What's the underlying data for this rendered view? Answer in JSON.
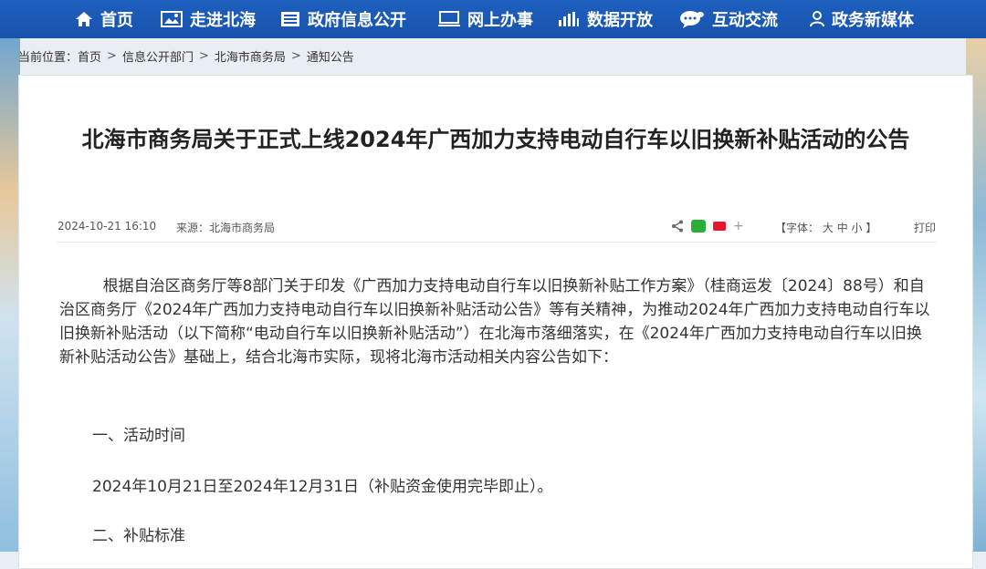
{
  "nav": {
    "items": [
      {
        "label": "首页",
        "icon": "home-icon"
      },
      {
        "label": "走进北海",
        "icon": "picture-icon"
      },
      {
        "label": "政府信息公开",
        "icon": "document-icon"
      },
      {
        "label": "网上办事",
        "icon": "monitor-icon"
      },
      {
        "label": "数据开放",
        "icon": "bar-chart-icon"
      },
      {
        "label": "互动交流",
        "icon": "chat-bubble-icon"
      },
      {
        "label": "政务新媒体",
        "icon": "user-icon"
      }
    ],
    "bg_color": "#1b59b5"
  },
  "breadcrumb": {
    "prefix": "当前位置：",
    "items": [
      "首页",
      "信息公开部门",
      "北海市商务局",
      "通知公告"
    ],
    "separator": ">"
  },
  "article": {
    "title": "北海市商务局关于正式上线2024年广西加力支持电动自行车以旧换新补贴活动的公告",
    "date": "2024-10-21 16:10",
    "source": "来源：北海市商务局",
    "font_size_label": "【字体：",
    "font_size_options": [
      "大",
      "中",
      "小"
    ],
    "font_size_close": "】",
    "print_label": "打印",
    "plus_symbol": "+",
    "paragraph1": "根据自治区商务厅等8部门关于印发《广西加力支持电动自行车以旧换新补贴工作方案》（桂商运发〔2024〕88号）和自治区商务厅《2024年广西加力支持电动自行车以旧换新补贴活动公告》等有关精神，为推动2024年广西加力支持电动自行车以旧换新补贴活动（以下简称“电动自行车以旧换新补贴活动”）在北海市落细落实，在《2024年广西加力支持电动自行车以旧换新补贴活动公告》基础上，结合北海市实际，现将北海市活动相关内容公告如下：",
    "section1_heading": "一、活动时间",
    "section1_text": "2024年10月21日至2024年12月31日（补贴资金使用完毕即止）。",
    "section2_heading": "二、补贴标准"
  }
}
